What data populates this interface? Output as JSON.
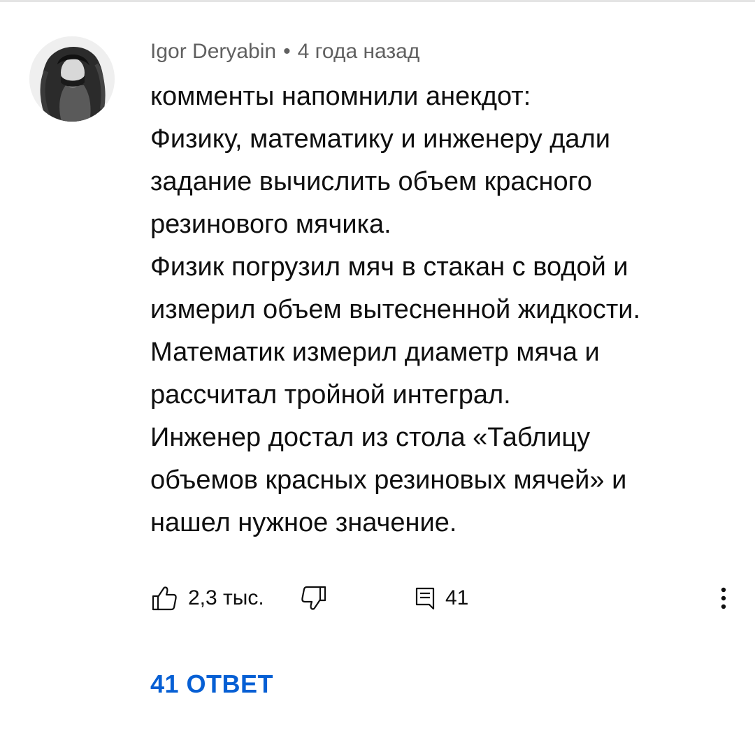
{
  "comment": {
    "author": "Igor Deryabin",
    "separator": "•",
    "timestamp": "4 года назад",
    "lines": [
      "комменты напомнили анекдот:",
      "Физику, математику и инженеру дали",
      "задание вычислить объем красного",
      "резинового мячика.",
      "Физик погрузил мяч в стакан с водой и",
      "измерил объем вытесненной жидкости.",
      "Математик измерил диаметр мяча и",
      "рассчитал тройной интеграл.",
      "Инженер достал из стола «Таблицу",
      "объемов красных резиновых мячей» и",
      "нашел нужное значение."
    ]
  },
  "actions": {
    "like_icon": "thumb-up-icon",
    "like_count": "2,3 тыс.",
    "dislike_icon": "thumb-down-icon",
    "reply_icon": "comment-icon",
    "reply_count": "41",
    "more_icon": "more-vertical-icon"
  },
  "replies_link": "41 ОТВЕТ",
  "colors": {
    "text_primary": "#0f0f0f",
    "text_secondary": "#606060",
    "link": "#065fd4"
  }
}
